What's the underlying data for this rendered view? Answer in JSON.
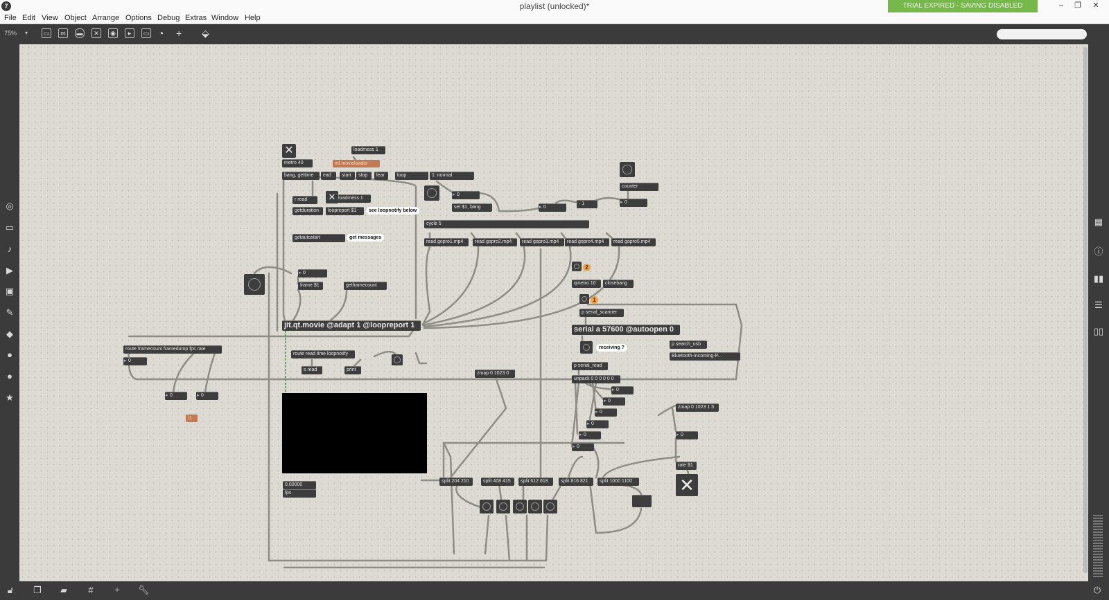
{
  "app": {
    "icon_glyph": "7",
    "window_title": "playlist (unlocked)*",
    "trial_banner": "TRIAL EXPIRED - SAVING DISABLED",
    "colors": {
      "banner": "#77b84a",
      "toolbar": "#3b3b3b",
      "object": "#3d3d3d",
      "canvas": "#dcdad3"
    }
  },
  "window_controls": {
    "minimize": "–",
    "restore": "❐",
    "close": "✕"
  },
  "menu": [
    "File",
    "Edit",
    "View",
    "Object",
    "Arrange",
    "Options",
    "Debug",
    "Extras",
    "Window",
    "Help"
  ],
  "toolbar": {
    "zoom": "75%",
    "zoom_caret": "▾",
    "icons": [
      "new-object-icon",
      "message-icon",
      "comment-icon",
      "button-icon",
      "toggle-icon",
      "slider-icon",
      "number-icon",
      "dial-icon",
      "add-icon",
      "paint-bucket-icon"
    ],
    "search_placeholder": ""
  },
  "left_sidebar": [
    "target-icon",
    "tv-icon",
    "note-icon",
    "media-icon",
    "image-icon",
    "pencil-icon",
    "plugin-icon",
    "v-badge-icon",
    "b-badge-icon",
    "star-icon"
  ],
  "right_sidebar": [
    "grid-icon",
    "info-icon",
    "book-icon",
    "list-icon",
    "reference-icon"
  ],
  "bottom_bar": [
    "lock-icon",
    "windows-icon",
    "presentation-icon",
    "grid-icon",
    "snap-icon",
    "wrench-icon"
  ],
  "objects": {
    "loadmess_top": "loadmess 1",
    "metro": "metro 40",
    "movieloader": "ml.movieloader",
    "bang_gettime": "bang, gettime",
    "read_msg": "ead",
    "start": "start",
    "stop": "stop",
    "clear": "lear",
    "loop": "loop",
    "normal": "1: normal",
    "r_read": "r read",
    "loadmess_mid": "loadmess 1",
    "getduration": "getduration",
    "loopreport": "loopreport $1",
    "see_loopnotify": "see loopnotify below",
    "num_a": "0",
    "set_bang": "set $1, bang",
    "num_b": "0",
    "minus_one": "- 1",
    "counter": "counter",
    "num_counter": "0",
    "cycle": "cycle 5",
    "getautostart": "getautostart",
    "get_messages": "get messages",
    "gopro1": "read gopro1.mp4",
    "gopro2": "read gopro2.mp4",
    "gopro3": "read gopro3.mp4",
    "gopro4": "read gopro4.mp4",
    "gopro5": "read gopro5.mp4",
    "num_frame": "0",
    "frame": "frame $1",
    "getframecount": "getframecount",
    "qmetro": "qmetro 10",
    "closebang": "closebang",
    "badge_two": "2",
    "badge_one": "1",
    "serial_scanner": "p serial_scanner",
    "jit_movie": "jit.qt.movie @adapt 1 @loopreport 1",
    "serial": "serial a 57600 @autoopen 0",
    "route_framecount": "route framecount framedump fps rate",
    "route_read": "route read time loopnotify",
    "num_route": "0",
    "s_read": "s read",
    "print": "print",
    "zmap_a": "zmap 0 1023 0",
    "receiving": "receiving ?",
    "search_usb": "p search_usb",
    "bluetooth": "Bluetooth-Incoming-P...",
    "serial_read": "p serial_read",
    "unpack": "unpack 0 0 0 0 0 0",
    "num_left1": "0",
    "num_left2": "0",
    "num_u1": "0",
    "num_u2": "0",
    "num_u3": "0",
    "num_u4": "0",
    "num_u5": "0",
    "num_u6": "0",
    "zmap_b": "zmap 0 1023 1 5",
    "num_zmap": "0",
    "rate": "rate $1",
    "divide": "/1.",
    "fps_value": "0.00000",
    "fps_label": "fps",
    "split1": "split 204 210",
    "split2": "split 408 415",
    "split3": "split 612 618",
    "split4": "split 816 821",
    "split5": "split 1000 1100"
  }
}
